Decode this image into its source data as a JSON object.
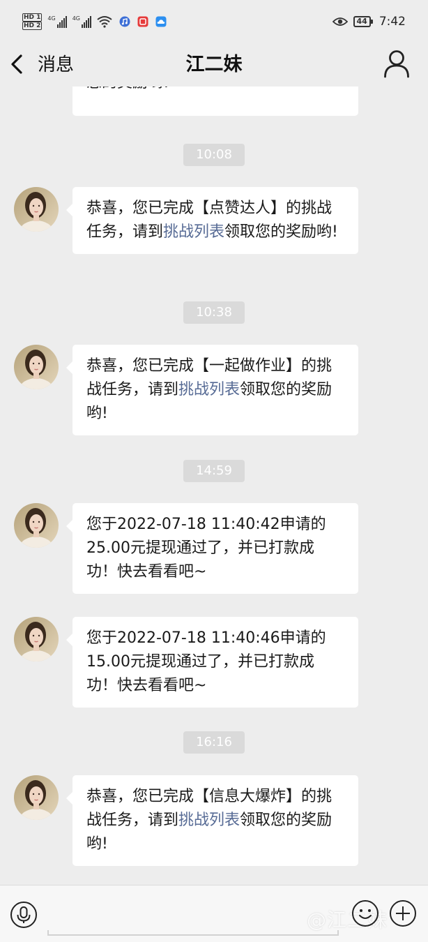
{
  "status_bar": {
    "hd1": "HD 1",
    "hd2": "HD 2",
    "net1": "4G",
    "net2": "4G",
    "battery": "44",
    "time": "7:42",
    "app_icons": [
      "music-icon",
      "red-app-icon",
      "cloud-icon"
    ]
  },
  "nav": {
    "back_label": "消息",
    "title": "江二妹"
  },
  "messages": [
    {
      "kind": "text",
      "partial": true,
      "parts": [
        {
          "t": "您的奖励哟!"
        }
      ]
    },
    {
      "kind": "time",
      "text": "10:08"
    },
    {
      "kind": "text",
      "parts": [
        {
          "t": "恭喜，您已完成【点赞达人】的挑战任务，请到"
        },
        {
          "t": "挑战列表",
          "link": true
        },
        {
          "t": "领取您的奖励哟!"
        }
      ]
    },
    {
      "kind": "time",
      "text": "10:38"
    },
    {
      "kind": "text",
      "parts": [
        {
          "t": "恭喜，您已完成【一起做作业】的挑战任务，请到"
        },
        {
          "t": "挑战列表",
          "link": true
        },
        {
          "t": "领取您的奖励哟!"
        }
      ]
    },
    {
      "kind": "time",
      "text": "14:59"
    },
    {
      "kind": "text",
      "parts": [
        {
          "t": "您于2022-07-18 11:40:42申请的25.00元提现通过了，并已打款成功！快去看看吧~"
        }
      ]
    },
    {
      "kind": "text",
      "parts": [
        {
          "t": "您于2022-07-18 11:40:46申请的15.00元提现通过了，并已打款成功！快去看看吧~"
        }
      ]
    },
    {
      "kind": "time",
      "text": "16:16"
    },
    {
      "kind": "text",
      "parts": [
        {
          "t": "恭喜，您已完成【信息大爆炸】的挑战任务，请到"
        },
        {
          "t": "挑战列表",
          "link": true
        },
        {
          "t": "领取您的奖励哟!"
        }
      ]
    }
  ],
  "input_bar": {
    "placeholder": "",
    "watermark": "@江二妹"
  },
  "colors": {
    "background": "#ededed",
    "bubble": "#ffffff",
    "link": "#576b95",
    "time_chip": "#dadada"
  }
}
